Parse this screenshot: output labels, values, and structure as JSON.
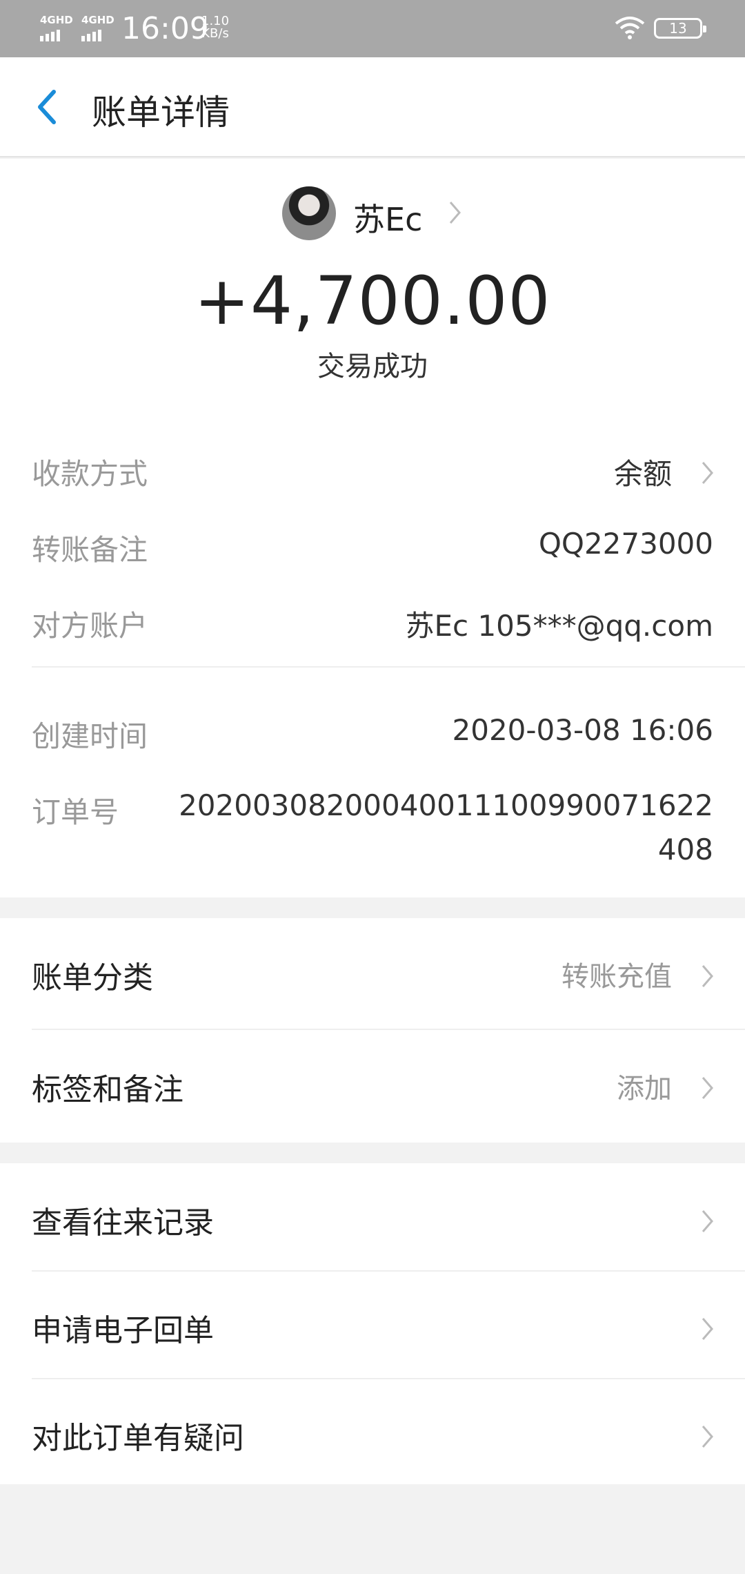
{
  "status_bar": {
    "net1": "4GHD",
    "net2": "4GHD",
    "time": "16:09",
    "speed_value": "1.10",
    "speed_unit": "KB/s",
    "battery": "13"
  },
  "header": {
    "back_icon": "chevron-left-icon",
    "title": "账单详情"
  },
  "payer": {
    "name": "苏Ec"
  },
  "amount": "+4,700.00",
  "status": "交易成功",
  "details": [
    {
      "label": "收款方式",
      "value": "余额"
    },
    {
      "label": "转账备注",
      "value": "QQ2273000"
    },
    {
      "label": "对方账户",
      "value": "苏Ec 105***@qq.com"
    },
    {
      "label": "创建时间",
      "value": "2020-03-08 16:06"
    },
    {
      "label": "订单号",
      "value": "20200308200040011100990071622408"
    }
  ],
  "category_section": [
    {
      "label": "账单分类",
      "value": "转账充值"
    },
    {
      "label": "标签和备注",
      "value": "添加"
    }
  ],
  "actions": [
    {
      "label": "查看往来记录"
    },
    {
      "label": "申请电子回单"
    },
    {
      "label": "对此订单有疑问"
    }
  ],
  "colors": {
    "accent": "#1a8cd8",
    "status_bar": "#a8a8a8",
    "page_bg": "#f2f2f2"
  }
}
